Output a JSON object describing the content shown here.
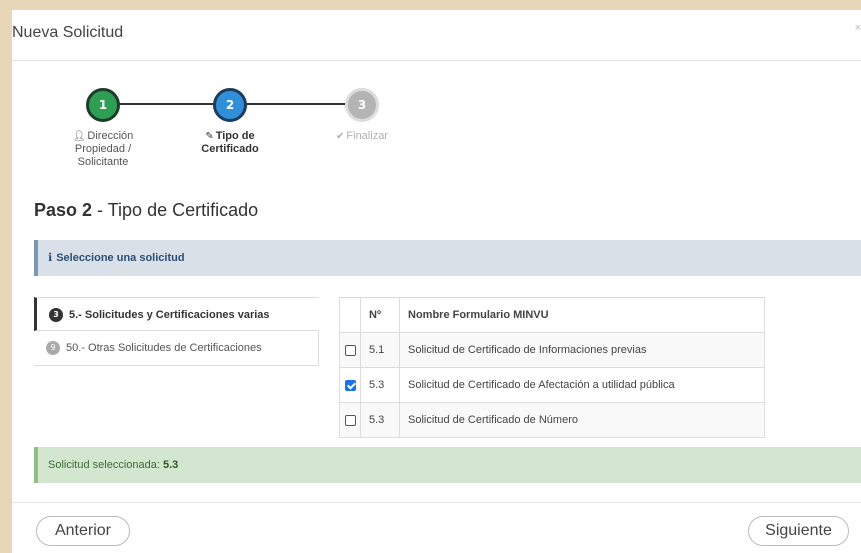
{
  "modal": {
    "title": "Nueva Solicitud",
    "close_label": "×"
  },
  "wizard": {
    "steps": [
      {
        "number": "1",
        "icon": "user-icon",
        "label": "Dirección Propiedad / Solicitante",
        "state": "done"
      },
      {
        "number": "2",
        "icon": "edit-icon",
        "label": "Tipo de Certificado",
        "state": "current"
      },
      {
        "number": "3",
        "icon": "check-icon",
        "label": "Finalizar",
        "state": "pending"
      }
    ]
  },
  "step_heading": {
    "prefix": "Paso 2",
    "text": " - Tipo de Certificado"
  },
  "info_alert": {
    "icon": "info-icon",
    "text": "Seleccione una solicitud"
  },
  "request_groups": [
    {
      "badge": "3",
      "label": "5.- Solicitudes y Certificaciones varias",
      "active": true
    },
    {
      "badge": "9",
      "label": "50.- Otras Solicitudes de Certificaciones",
      "active": false
    }
  ],
  "table": {
    "headers": {
      "check": "",
      "number": "Nº",
      "name": "Nombre Formulario MINVU"
    },
    "rows": [
      {
        "checked": false,
        "number": "5.1",
        "name": "Solicitud de Certificado de Informaciones previas"
      },
      {
        "checked": true,
        "number": "5.3",
        "name": "Solicitud de Certificado de Afectación a utilidad pública"
      },
      {
        "checked": false,
        "number": "5.3",
        "name": "Solicitud de Certificado de Número"
      }
    ]
  },
  "success_alert": {
    "label": "Solicitud seleccionada: ",
    "value": "5.3"
  },
  "footer": {
    "prev_label": "Anterior",
    "next_label": "Siguiente"
  },
  "colors": {
    "accent": "#2f8fd8",
    "done": "#2e9e55",
    "pending": "#b4b4b4",
    "page_bg": "#e8d6b8"
  }
}
